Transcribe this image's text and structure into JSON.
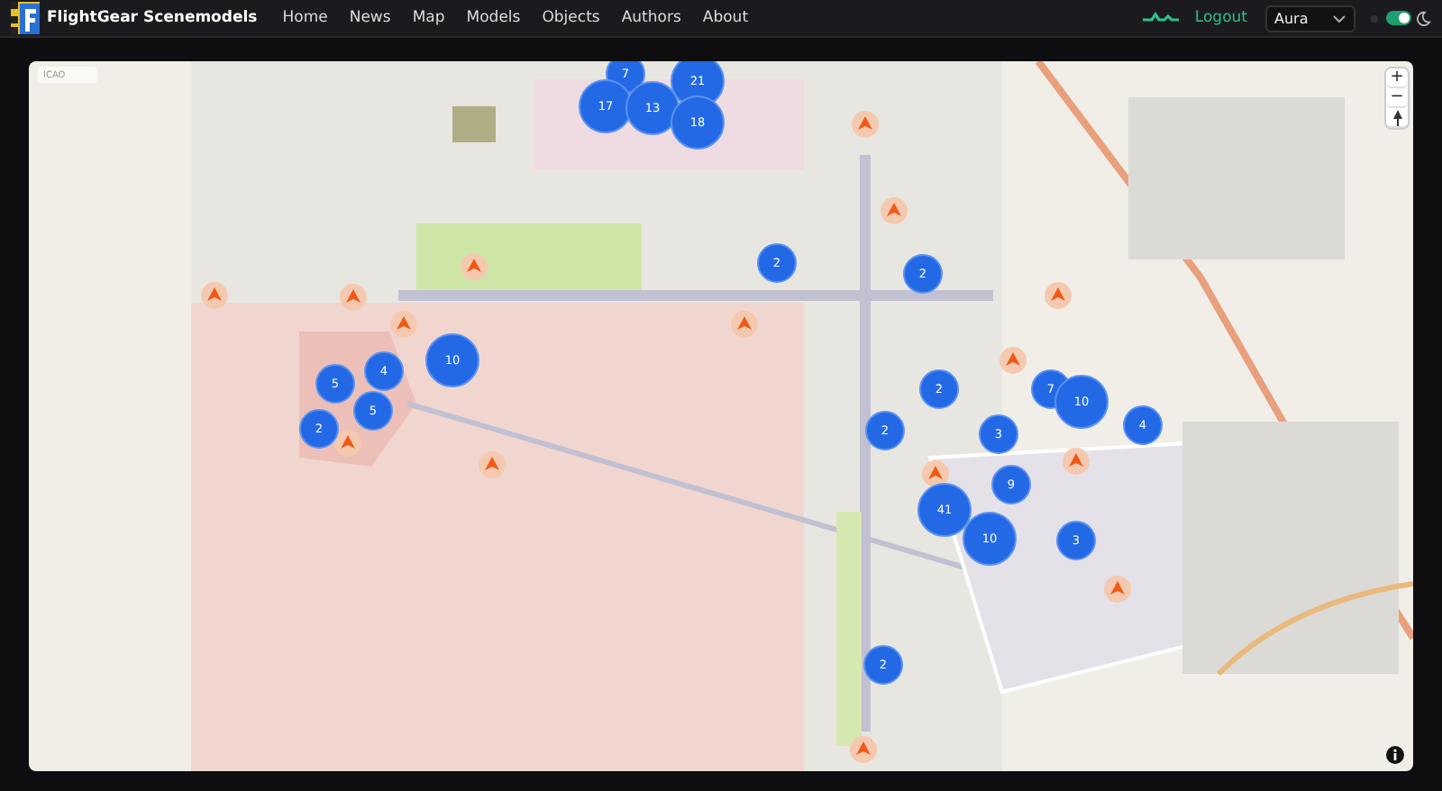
{
  "navbar": {
    "brand": "FlightGear Scenemodels",
    "links": [
      {
        "label": "Home"
      },
      {
        "label": "News"
      },
      {
        "label": "Map"
      },
      {
        "label": "Models"
      },
      {
        "label": "Objects"
      },
      {
        "label": "Authors"
      },
      {
        "label": "About"
      }
    ],
    "logout": "Logout",
    "theme_select": {
      "value": "Aura"
    },
    "dark_mode_toggle": {
      "on": true
    }
  },
  "map": {
    "search": {
      "placeholder": "ICAO"
    },
    "zoom_controls": [
      {
        "label": "+"
      },
      {
        "label": "−"
      }
    ],
    "clusters": [
      {
        "count": "7"
      },
      {
        "count": "21"
      },
      {
        "count": "17"
      },
      {
        "count": "13"
      },
      {
        "count": "18"
      },
      {
        "count": "2"
      },
      {
        "count": "2"
      },
      {
        "count": "10"
      },
      {
        "count": "4"
      },
      {
        "count": "5"
      },
      {
        "count": "2"
      },
      {
        "count": "7"
      },
      {
        "count": "10"
      },
      {
        "count": "2"
      },
      {
        "count": "5"
      },
      {
        "count": "2"
      },
      {
        "count": "3"
      },
      {
        "count": "4"
      },
      {
        "count": "9"
      },
      {
        "count": "41"
      },
      {
        "count": "10"
      },
      {
        "count": "3"
      },
      {
        "count": "2"
      }
    ]
  }
}
